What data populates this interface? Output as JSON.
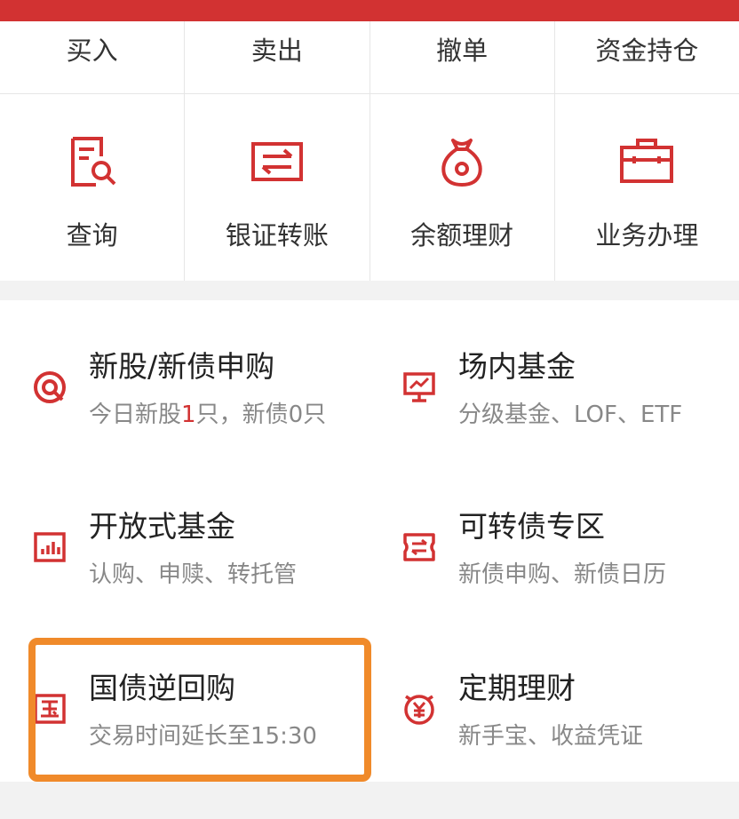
{
  "accent": "#d23232",
  "quick_actions": [
    "买入",
    "卖出",
    "撤单",
    "资金持仓"
  ],
  "icon_actions": [
    {
      "label": "查询",
      "icon": "search-document-icon"
    },
    {
      "label": "银证转账",
      "icon": "transfer-icon"
    },
    {
      "label": "余额理财",
      "icon": "money-bag-icon"
    },
    {
      "label": "业务办理",
      "icon": "briefcase-icon"
    }
  ],
  "products": [
    {
      "title": "新股/新债申购",
      "sub_prefix": "今日新股",
      "sub_highlight": "1",
      "sub_suffix": "只，新债0只",
      "icon": "target-icon"
    },
    {
      "title": "场内基金",
      "sub": "分级基金、LOF、ETF",
      "icon": "monitor-chart-icon"
    },
    {
      "title": "开放式基金",
      "sub": "认购、申赎、转托管",
      "icon": "bar-chart-icon"
    },
    {
      "title": "可转债专区",
      "sub": "新债申购、新债日历",
      "icon": "exchange-ticket-icon"
    },
    {
      "title": "国债逆回购",
      "sub": "交易时间延长至15:30",
      "icon": "national-bond-icon"
    },
    {
      "title": "定期理财",
      "sub": "新手宝、收益凭证",
      "icon": "yen-clock-icon"
    }
  ]
}
